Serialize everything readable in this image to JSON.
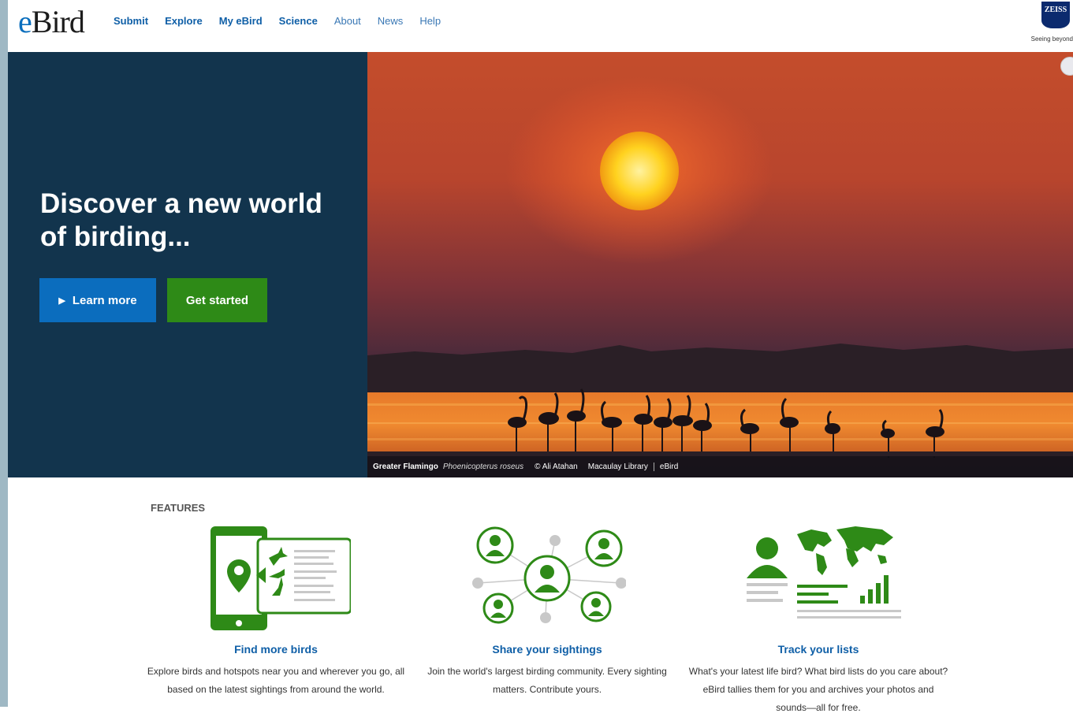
{
  "header": {
    "logo": "eBird",
    "nav": [
      {
        "label": "Submit"
      },
      {
        "label": "Explore"
      },
      {
        "label": "My eBird"
      },
      {
        "label": "Science"
      },
      {
        "label": "About"
      },
      {
        "label": "News"
      },
      {
        "label": "Help"
      }
    ],
    "sponsor": {
      "name": "ZEISS",
      "tagline": "Seeing beyond"
    }
  },
  "hero": {
    "title": "Discover a new world of birding...",
    "learn_more": "Learn more",
    "get_started": "Get started",
    "caption": {
      "common_name": "Greater Flamingo",
      "scientific_name": "Phoenicopterus roseus",
      "photographer": "© Ali Atahan",
      "library": "Macaulay Library",
      "source": "eBird"
    }
  },
  "features": {
    "heading": "FEATURES",
    "items": [
      {
        "title": "Find more birds",
        "description": "Explore birds and hotspots near you and wherever you go, all based on the latest sightings from around the world."
      },
      {
        "title": "Share your sightings",
        "description": "Join the world's largest birding community. Every sighting matters. Contribute yours."
      },
      {
        "title": "Track your lists",
        "description": "What's your latest life bird? What bird lists do you care about? eBird tallies them for you and archives your photos and sounds—all for free."
      }
    ]
  },
  "colors": {
    "brand_blue": "#0b6dbe",
    "brand_green": "#2e8a17",
    "hero_bg": "#12344d"
  }
}
